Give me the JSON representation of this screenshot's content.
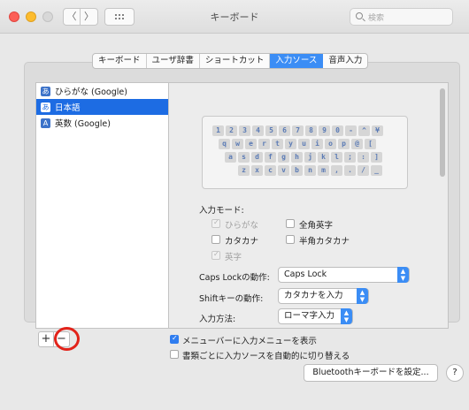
{
  "window": {
    "title": "キーボード"
  },
  "search": {
    "placeholder": "検索"
  },
  "tabs": [
    "キーボード",
    "ユーザ辞書",
    "ショートカット",
    "入力ソース",
    "音声入力"
  ],
  "input_sources": [
    {
      "badge": "あ",
      "label": "ひらがな (Google)",
      "selected": false
    },
    {
      "badge": "あ",
      "label": "日本語",
      "selected": true
    },
    {
      "badge": "A",
      "label": "英数 (Google)",
      "selected": false
    }
  ],
  "keyboard_rows": [
    [
      "1",
      "2",
      "3",
      "4",
      "5",
      "6",
      "7",
      "8",
      "9",
      "0",
      "-",
      "^",
      "¥"
    ],
    [
      "q",
      "w",
      "e",
      "r",
      "t",
      "y",
      "u",
      "i",
      "o",
      "p",
      "@",
      "["
    ],
    [
      "a",
      "s",
      "d",
      "f",
      "g",
      "h",
      "j",
      "k",
      "l",
      ";",
      ":",
      "]"
    ],
    [
      "z",
      "x",
      "c",
      "v",
      "b",
      "n",
      "m",
      ",",
      ".",
      "/",
      "_"
    ]
  ],
  "input_modes": {
    "heading": "入力モード:",
    "hiragana": "ひらがな",
    "katakana": "カタカナ",
    "eisu": "英字",
    "zenkaku": "全角英字",
    "hankaku_katakana": "半角カタカナ"
  },
  "settings": {
    "caps_label": "Caps Lockの動作:",
    "caps_value": "Caps Lock",
    "shift_label": "Shiftキーの動作:",
    "shift_value": "カタカナを入力",
    "method_label": "入力方法:",
    "method_value": "ローマ字入力"
  },
  "controls": {
    "plus": "+",
    "minus": "−"
  },
  "options": {
    "show_menu": "メニューバーに入力メニューを表示",
    "auto_switch": "書類ごとに入力ソースを自動的に切り替える"
  },
  "footer": {
    "bluetooth_button": "Bluetoothキーボードを設定...",
    "help": "?"
  },
  "nav": {
    "back": "〈",
    "forward": "〉"
  }
}
